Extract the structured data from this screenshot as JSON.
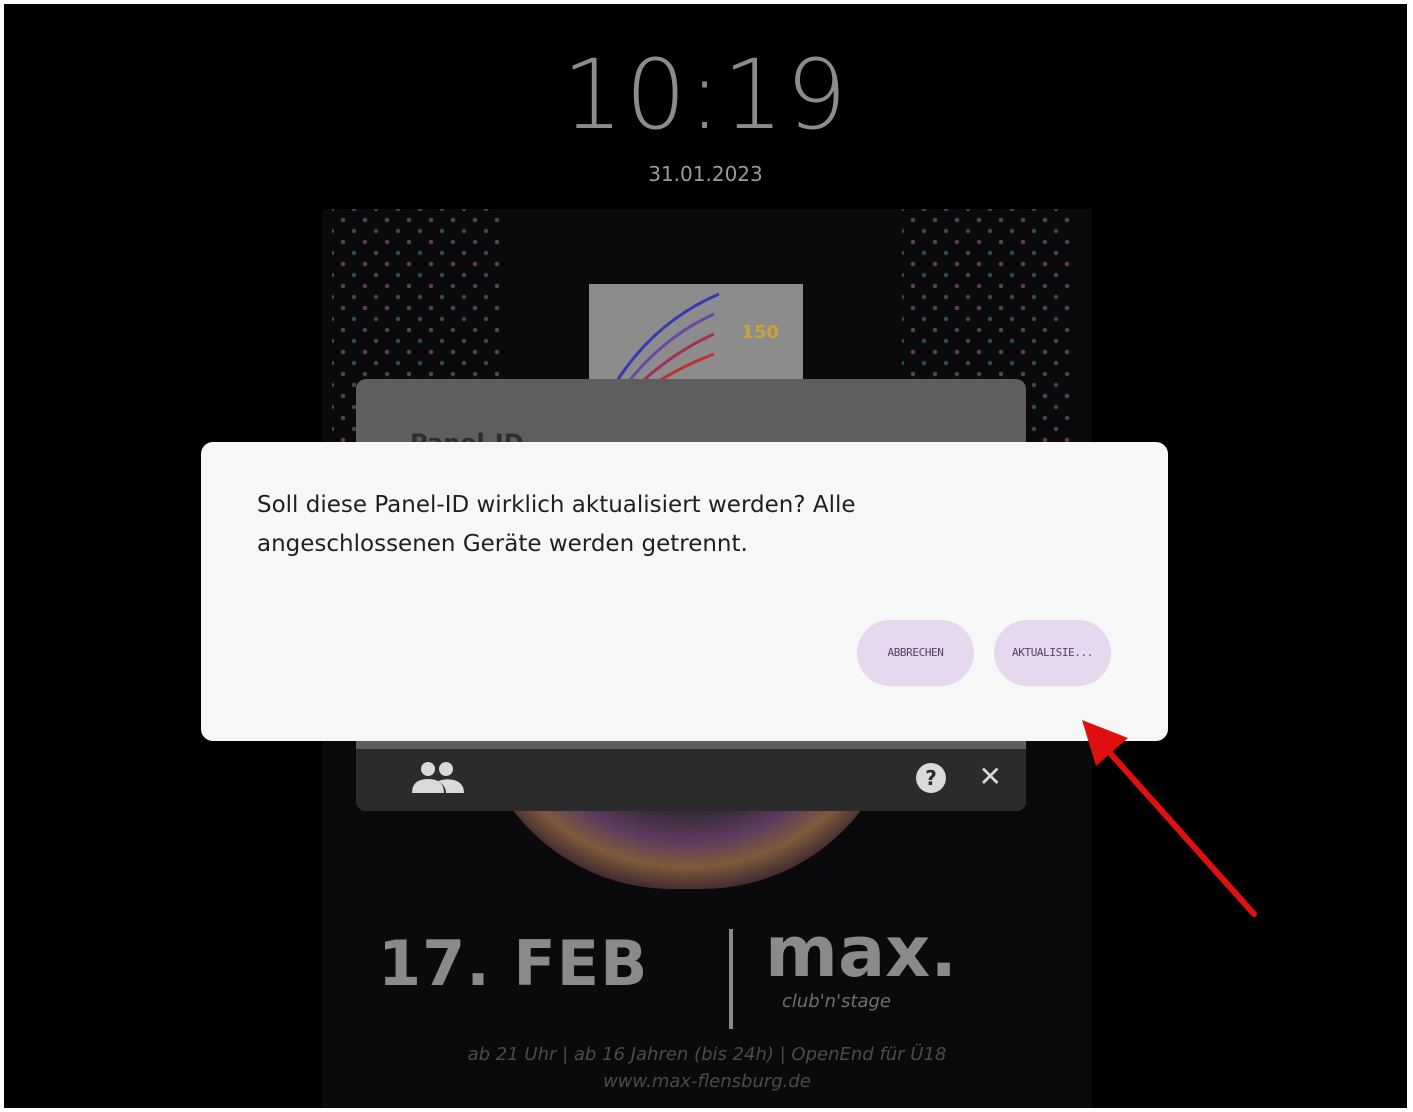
{
  "lockscreen": {
    "time": "10:19",
    "date": "31.01.2023"
  },
  "poster": {
    "logo_badge": "150",
    "event_date": "17. FEB",
    "venue": "max.",
    "venue_tag": "club'n'stage",
    "info_line_1": "ab 21 Uhr | ab 16 Jahren (bis 24h) | OpenEnd für Ü18",
    "info_line_2": "www.max-flensburg.de"
  },
  "panel_dialog": {
    "title": "Panel-ID",
    "footer_icons": [
      "people-icon",
      "help-icon",
      "close-icon"
    ]
  },
  "confirm_dialog": {
    "message": "Soll diese Panel-ID wirklich aktualisiert werden? Alle angeschlossenen Geräte werden getrennt.",
    "cancel_label": "ABBRECHEN",
    "confirm_label": "AKTUALISIE..."
  },
  "colors": {
    "dialog_bg": "#f7f7f8",
    "button_bg": "#e6d8ee",
    "button_text": "#5a3e6a",
    "annotation_arrow": "#e01010"
  }
}
